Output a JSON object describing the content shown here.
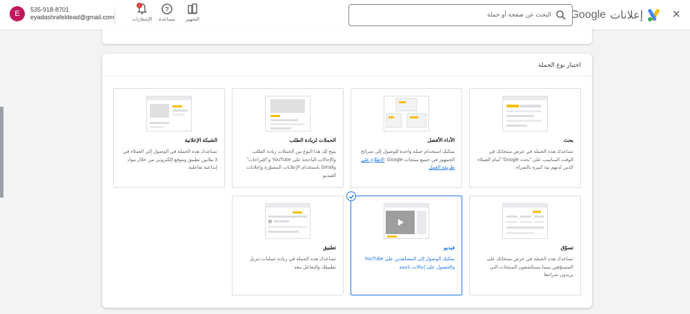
{
  "header": {
    "close_symbol": "×",
    "logo_ads_text": "إعلانات",
    "logo_google_text": "Google",
    "search_placeholder": "البحث عن صفحة أو حملة",
    "tools": [
      {
        "label": "التجهيز",
        "icon": "tools-icon"
      },
      {
        "label": "مساعدة",
        "icon": "help-icon"
      },
      {
        "label": "الإشعارات",
        "icon": "bell-icon",
        "badge": "!"
      }
    ],
    "account": {
      "avatar_letter": "E",
      "phone": "535-918-8701",
      "email": "eyadashrafeldead@gmail.com"
    }
  },
  "section": {
    "title": "اختيار نوع الحملة"
  },
  "options": [
    {
      "name": "بحث",
      "desc": "تساعدك هذه الحملة في عرض منتجاتك في الوقت المناسب على \"بحث Google\" أمام العملاء الذين لديهم نية كبيرة بالشراء."
    },
    {
      "name": "الأداء الأفضل",
      "desc": "يمكنك استخدام حملة واحدة للوصول إلى شرائح الجمهور في جميع منتجات Google.",
      "link": "الاطلاع على طريقة العمل"
    },
    {
      "name": "الحملات لزيادة الطلب",
      "desc": "يتيح لك هذا النوع من الحملات زيادة الطلب والإحالات الناجحة على YouTube و\"اقتراحات\" وGmail باستخدام الإعلانات المصوّرة وإعلانات الفيديو."
    },
    {
      "name": "الشبكة الإعلانية",
      "desc": "تساعدك هذه الحملة في الوصول إلى العملاء في 3 ملايين تطبيق وموقع إلكتروني من خلال مواد إبداعية تفاعلية."
    },
    {
      "name": "تسوّق",
      "desc": "تساعدك هذه الحملة في عرض منتجاتك على المتسوّقين بينما يستكشفون المنتجات التي يريدون شراءها"
    },
    {
      "name": "فيديو",
      "desc": "يمكنك الوصول إلى المشاهدين على YouTube والحصول على إحالات ناجحة",
      "selected": true
    },
    {
      "name": "تطبيق",
      "desc": "تساعدك هذه الحملة في زيادة عمليات تنزيل تطبيقك والتفاعل معه"
    }
  ],
  "colors": {
    "accent": "#1a73e8",
    "avatar": "#c2185b",
    "yellow": "#fbbc04",
    "badge": "#d93025"
  }
}
